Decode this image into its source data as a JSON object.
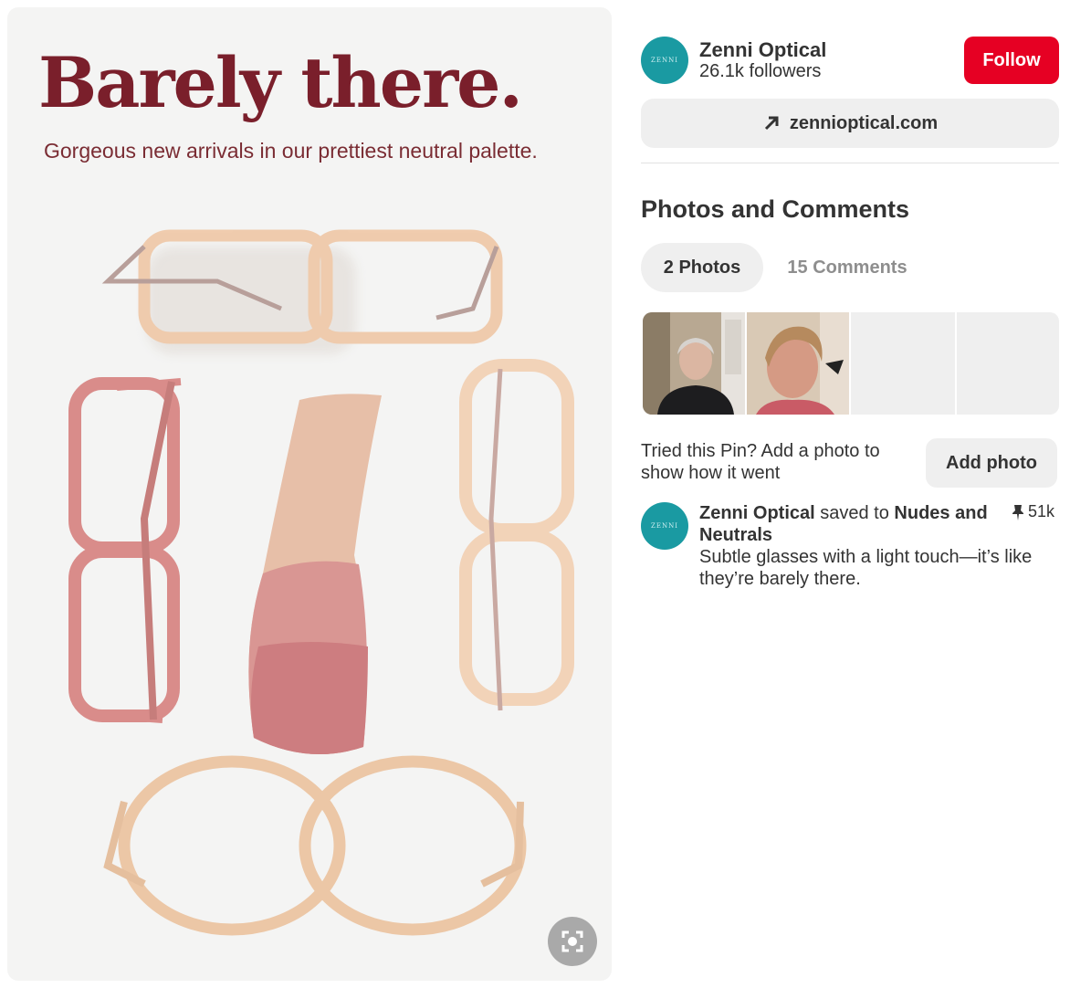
{
  "pin": {
    "headline": "Barely there.",
    "subheadline": "Gorgeous new arrivals in our prettiest neutral palette.",
    "expand_icon": "expand-icon"
  },
  "brand": {
    "name": "Zenni Optical",
    "followers": "26.1k followers",
    "avatar_mark": "ZENNI",
    "follow_label": "Follow",
    "follow_color": "#e60023",
    "accent_color": "#1a9aa2"
  },
  "link": {
    "icon": "arrow-up-right-icon",
    "label": "zennioptical.com"
  },
  "photos_comments": {
    "title": "Photos and Comments",
    "tabs": [
      {
        "label": "2 Photos",
        "active": true
      },
      {
        "label": "15 Comments",
        "active": false
      }
    ],
    "tried_text": "Tried this Pin? Add a photo to show how it went",
    "add_photo_label": "Add photo"
  },
  "saved": {
    "saver": "Zenni Optical",
    "saved_to_text": "saved to",
    "board": "Nudes and Neutrals",
    "saves_count": "51k",
    "pin_icon": "pushpin-icon",
    "description": "Subtle glasses with a light touch—it’s like they’re barely there."
  }
}
